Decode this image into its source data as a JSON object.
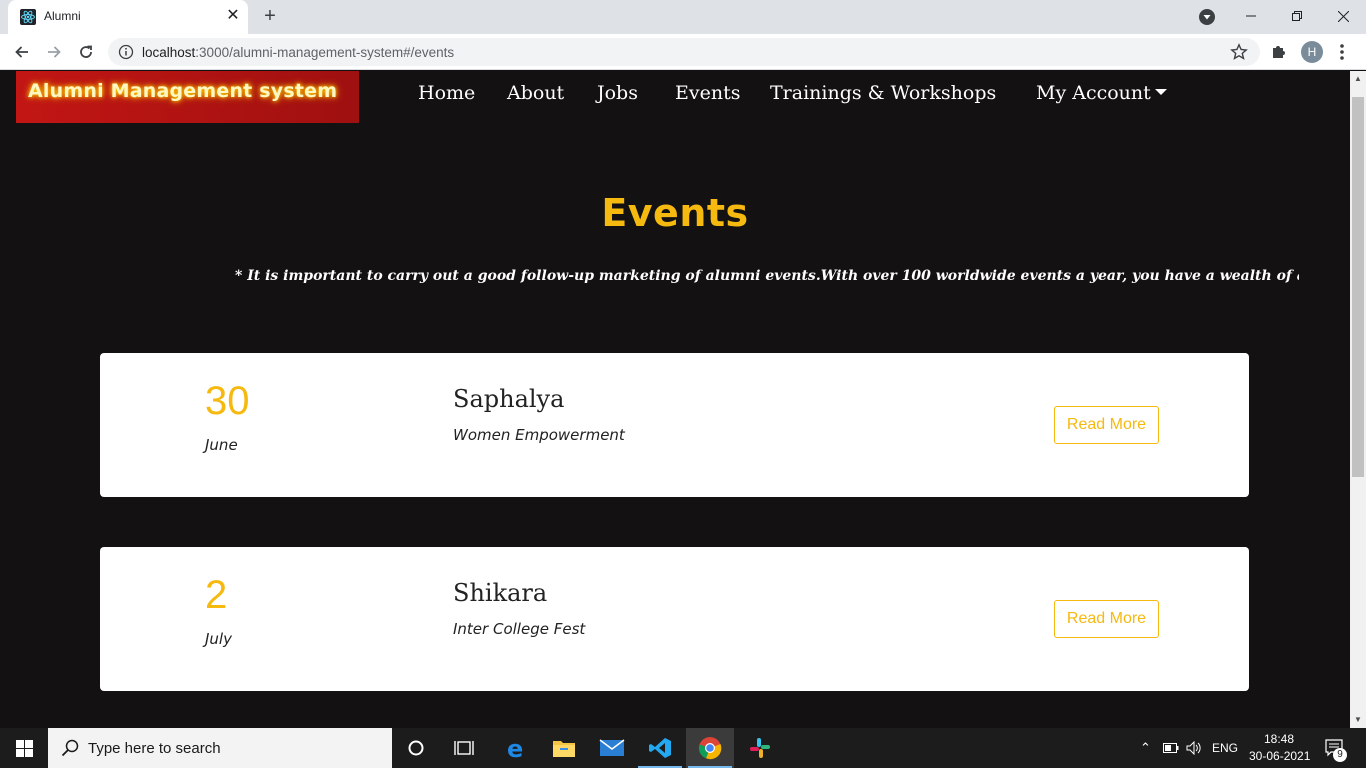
{
  "browser": {
    "tab_title": "Alumni",
    "url_host": "localhost",
    "url_rest": ":3000/alumni-management-system#/events",
    "profile_initial": "H"
  },
  "site": {
    "brand": "Alumni Management system",
    "nav": {
      "home": "Home",
      "about": "About",
      "jobs": "Jobs",
      "events": "Events",
      "trainings": "Trainings & Workshops",
      "account": "My Account"
    },
    "page_title": "Events",
    "marquee": "* It is important to carry out a good follow-up marketing of alumni events.With over 100 worldwide events a year, you have a wealth of alumni netu"
  },
  "events": [
    {
      "day": "30",
      "month": "June",
      "title": "Saphalya",
      "subtitle": "Women Empowerment",
      "button": "Read More"
    },
    {
      "day": "2",
      "month": "July",
      "title": "Shikara",
      "subtitle": "Inter College Fest",
      "button": "Read More"
    }
  ],
  "taskbar": {
    "search_placeholder": "Type here to search",
    "language": "ENG",
    "time": "18:48",
    "date": "30-06-2021",
    "notification_count": "9"
  },
  "colors": {
    "accent": "#f6b90f",
    "brand_bg": "#c21614",
    "page_bg": "#131112"
  }
}
